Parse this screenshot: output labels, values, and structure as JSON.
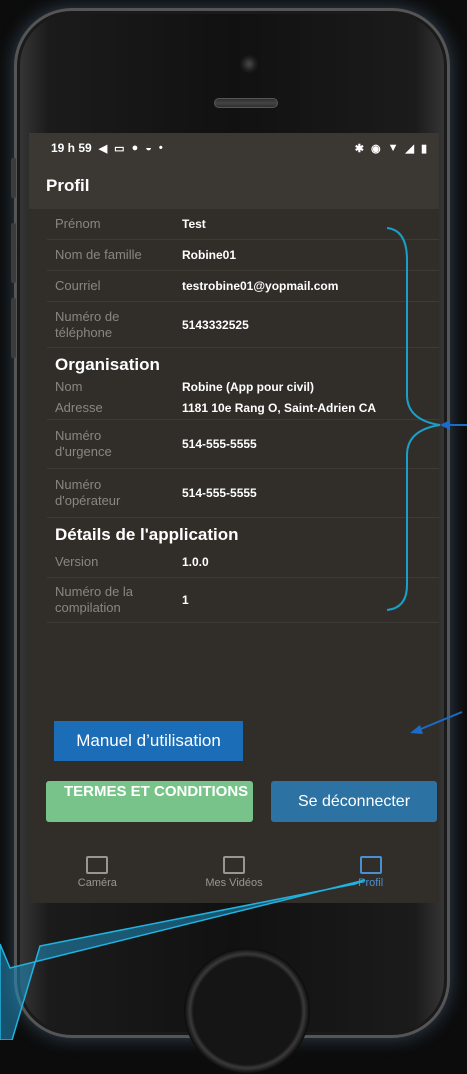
{
  "status": {
    "time": "19 h 59"
  },
  "appbar": {
    "title": "Profil"
  },
  "profile": [
    {
      "label": "Prénom",
      "value": "Test"
    },
    {
      "label": "Nom de famille",
      "value": "Robine01"
    },
    {
      "label": "Courriel",
      "value": "testrobine01@yopmail.com"
    },
    {
      "label": "Numéro de téléphone",
      "value": "5143332525"
    }
  ],
  "organisation": {
    "title": "Organisation",
    "rows": [
      {
        "label": "Nom",
        "value": "Robine (App pour civil)"
      },
      {
        "label": "Adresse",
        "value": "1181 10e Rang O, Saint-Adrien CA"
      },
      {
        "label": "Numéro d'urgence",
        "value": "514-555-5555"
      },
      {
        "label": "Numéro d'opérateur",
        "value": "514-555-5555"
      }
    ]
  },
  "app_details": {
    "title": "Détails de l'application",
    "rows": [
      {
        "label": "Version",
        "value": "1.0.0"
      },
      {
        "label": "Numéro de la compilation",
        "value": "1"
      }
    ]
  },
  "buttons": {
    "manual": "Manuel d’utilisation",
    "terms": "TERMES ET CONDITIONS",
    "logout": "Se déconnecter"
  },
  "nav": [
    {
      "label": "Caméra",
      "icon": "camera-icon"
    },
    {
      "label": "Mes Vidéos",
      "icon": "video-list-icon"
    },
    {
      "label": "Profil",
      "icon": "profile-icon"
    }
  ],
  "colors": {
    "accent": "#4b8fd0",
    "manual_button": "#1b6db7",
    "terms_button": "#77c38a",
    "logout_button": "#2c73a3",
    "annotation": "#1aa0c8"
  }
}
